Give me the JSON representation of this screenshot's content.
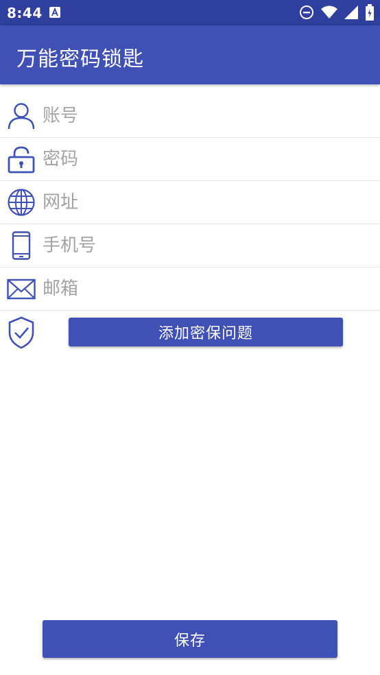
{
  "status_bar": {
    "time": "8:44",
    "icons": [
      "text-a-notification-icon",
      "do-not-disturb-icon",
      "wifi-icon",
      "signal-icon",
      "battery-icon"
    ]
  },
  "app_bar": {
    "title": "万能密码锁匙"
  },
  "form": {
    "account": {
      "placeholder": "账号",
      "value": "",
      "icon": "person-icon"
    },
    "password": {
      "placeholder": "密码",
      "value": "",
      "icon": "lock-icon"
    },
    "url": {
      "placeholder": "网址",
      "value": "",
      "icon": "globe-icon"
    },
    "phone": {
      "placeholder": "手机号",
      "value": "",
      "icon": "smartphone-icon"
    },
    "email": {
      "placeholder": "邮箱",
      "value": "",
      "icon": "envelope-icon"
    }
  },
  "security_question": {
    "icon": "shield-check-icon",
    "button_label": "添加密保问题"
  },
  "save_button": {
    "label": "保存"
  },
  "colors": {
    "primary": "#3f51b5",
    "primary_dark": "#2f3f9e",
    "icon": "#3f51b5",
    "placeholder": "#a3a3a3"
  }
}
